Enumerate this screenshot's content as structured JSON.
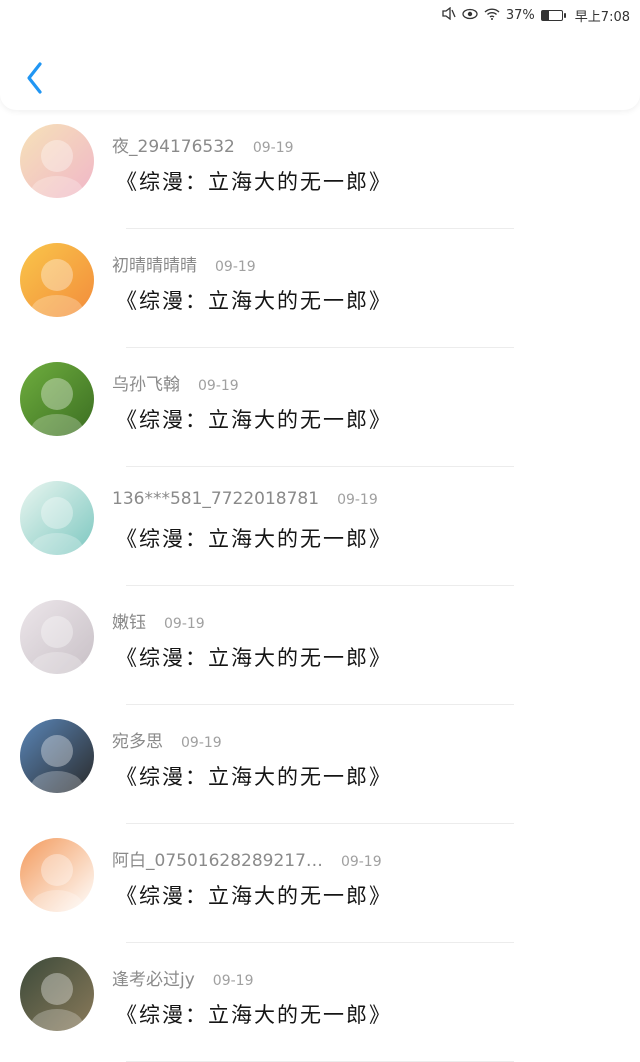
{
  "status_bar": {
    "battery_percent": "37%",
    "battery_level": 0.37,
    "time": "早上7:08",
    "icons": [
      "mute-icon",
      "eye-icon",
      "wifi-icon"
    ]
  },
  "header": {
    "back_icon": "chevron-left-icon",
    "accent_color": "#2196F3"
  },
  "items": [
    {
      "username": "夜_294176532",
      "date": "09-19",
      "title": "《综漫：立海大的无一郎》",
      "avatar_colors": [
        "#f6e2b8",
        "#f0b6c8"
      ]
    },
    {
      "username": "初晴晴晴晴",
      "date": "09-19",
      "title": "《综漫：立海大的无一郎》",
      "avatar_colors": [
        "#f9c64a",
        "#f38c3c"
      ]
    },
    {
      "username": "乌孙飞翰",
      "date": "09-19",
      "title": "《综漫：立海大的无一郎》",
      "avatar_colors": [
        "#6fae3e",
        "#3b6e22"
      ]
    },
    {
      "username": "136***581_7722018781",
      "date": "09-19",
      "title": "《综漫：立海大的无一郎》",
      "avatar_colors": [
        "#eaf6f0",
        "#7cc7c0"
      ]
    },
    {
      "username": "嫩钰",
      "date": "09-19",
      "title": "《综漫：立海大的无一郎》",
      "avatar_colors": [
        "#ece6ea",
        "#c8c0c6"
      ]
    },
    {
      "username": "宛多思",
      "date": "09-19",
      "title": "《综漫：立海大的无一郎》",
      "avatar_colors": [
        "#5a86b8",
        "#2a2a2a"
      ]
    },
    {
      "username": "阿白_07501628289217…",
      "date": "09-19",
      "title": "《综漫：立海大的无一郎》",
      "avatar_colors": [
        "#f39a5c",
        "#ffffff"
      ]
    },
    {
      "username": "逢考必过jy",
      "date": "09-19",
      "title": "《综漫：立海大的无一郎》",
      "avatar_colors": [
        "#3c4a3a",
        "#8a7a5a"
      ]
    }
  ]
}
